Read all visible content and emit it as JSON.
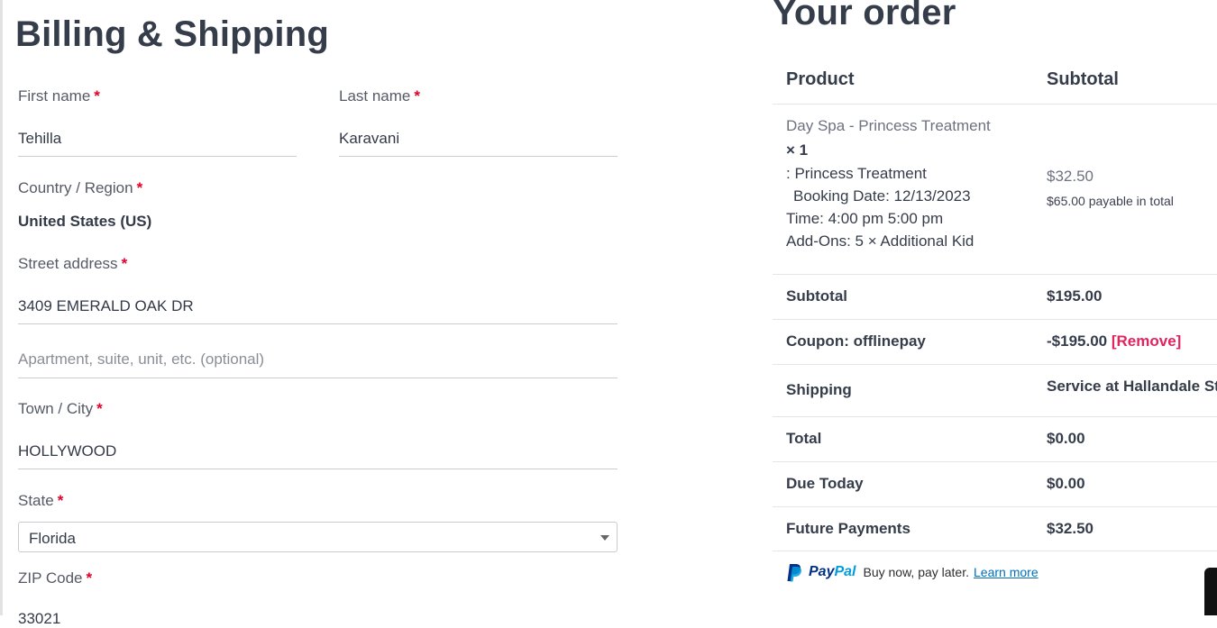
{
  "billing": {
    "title": "Billing & Shipping",
    "required_mark": "*",
    "first_name": {
      "label": "First name",
      "value": "Tehilla"
    },
    "last_name": {
      "label": "Last name",
      "value": "Karavani"
    },
    "country": {
      "label": "Country / Region",
      "value": "United States (US)"
    },
    "street": {
      "label": "Street address",
      "value": "3409 EMERALD OAK DR",
      "placeholder2": "Apartment, suite, unit, etc. (optional)"
    },
    "city": {
      "label": "Town / City",
      "value": "HOLLYWOOD"
    },
    "state": {
      "label": "State",
      "value": "Florida"
    },
    "zip": {
      "label": "ZIP Code",
      "value": "33021"
    }
  },
  "order": {
    "title": "Your order",
    "col_product": "Product",
    "col_subtotal": "Subtotal",
    "item": {
      "name": "Day Spa - Princess Treatment",
      "qty": "× 1",
      "line1": ": Princess Treatment",
      "line2": "Booking Date: 12/13/2023",
      "line3": "Time: 4:00 pm 5:00 pm",
      "line4": "Add-Ons: 5 × Additional Kid",
      "price": "$32.50",
      "payable": "$65.00 payable in total"
    },
    "rows": {
      "subtotal_label": "Subtotal",
      "subtotal_value": "$195.00",
      "coupon_label": "Coupon: offlinepay",
      "coupon_value": "-$195.00",
      "coupon_remove": "[Remove]",
      "shipping_label": "Shipping",
      "shipping_value": "Service at Hallandale Store",
      "total_label": "Total",
      "total_value": "$0.00",
      "due_label": "Due Today",
      "due_value": "$0.00",
      "future_label": "Future Payments",
      "future_value": "$32.50"
    },
    "paypal": {
      "logo_text": "PayPal",
      "message": "Buy now, pay later.",
      "link": "Learn more"
    }
  },
  "icons": {
    "paypal": "paypal-icon",
    "dropdown": "chevron-down-icon"
  },
  "colors": {
    "required": "#e3002b",
    "remove": "#e0245e",
    "paypal_blue": "#003087",
    "paypal_light": "#009cde",
    "link": "#0070ba"
  }
}
